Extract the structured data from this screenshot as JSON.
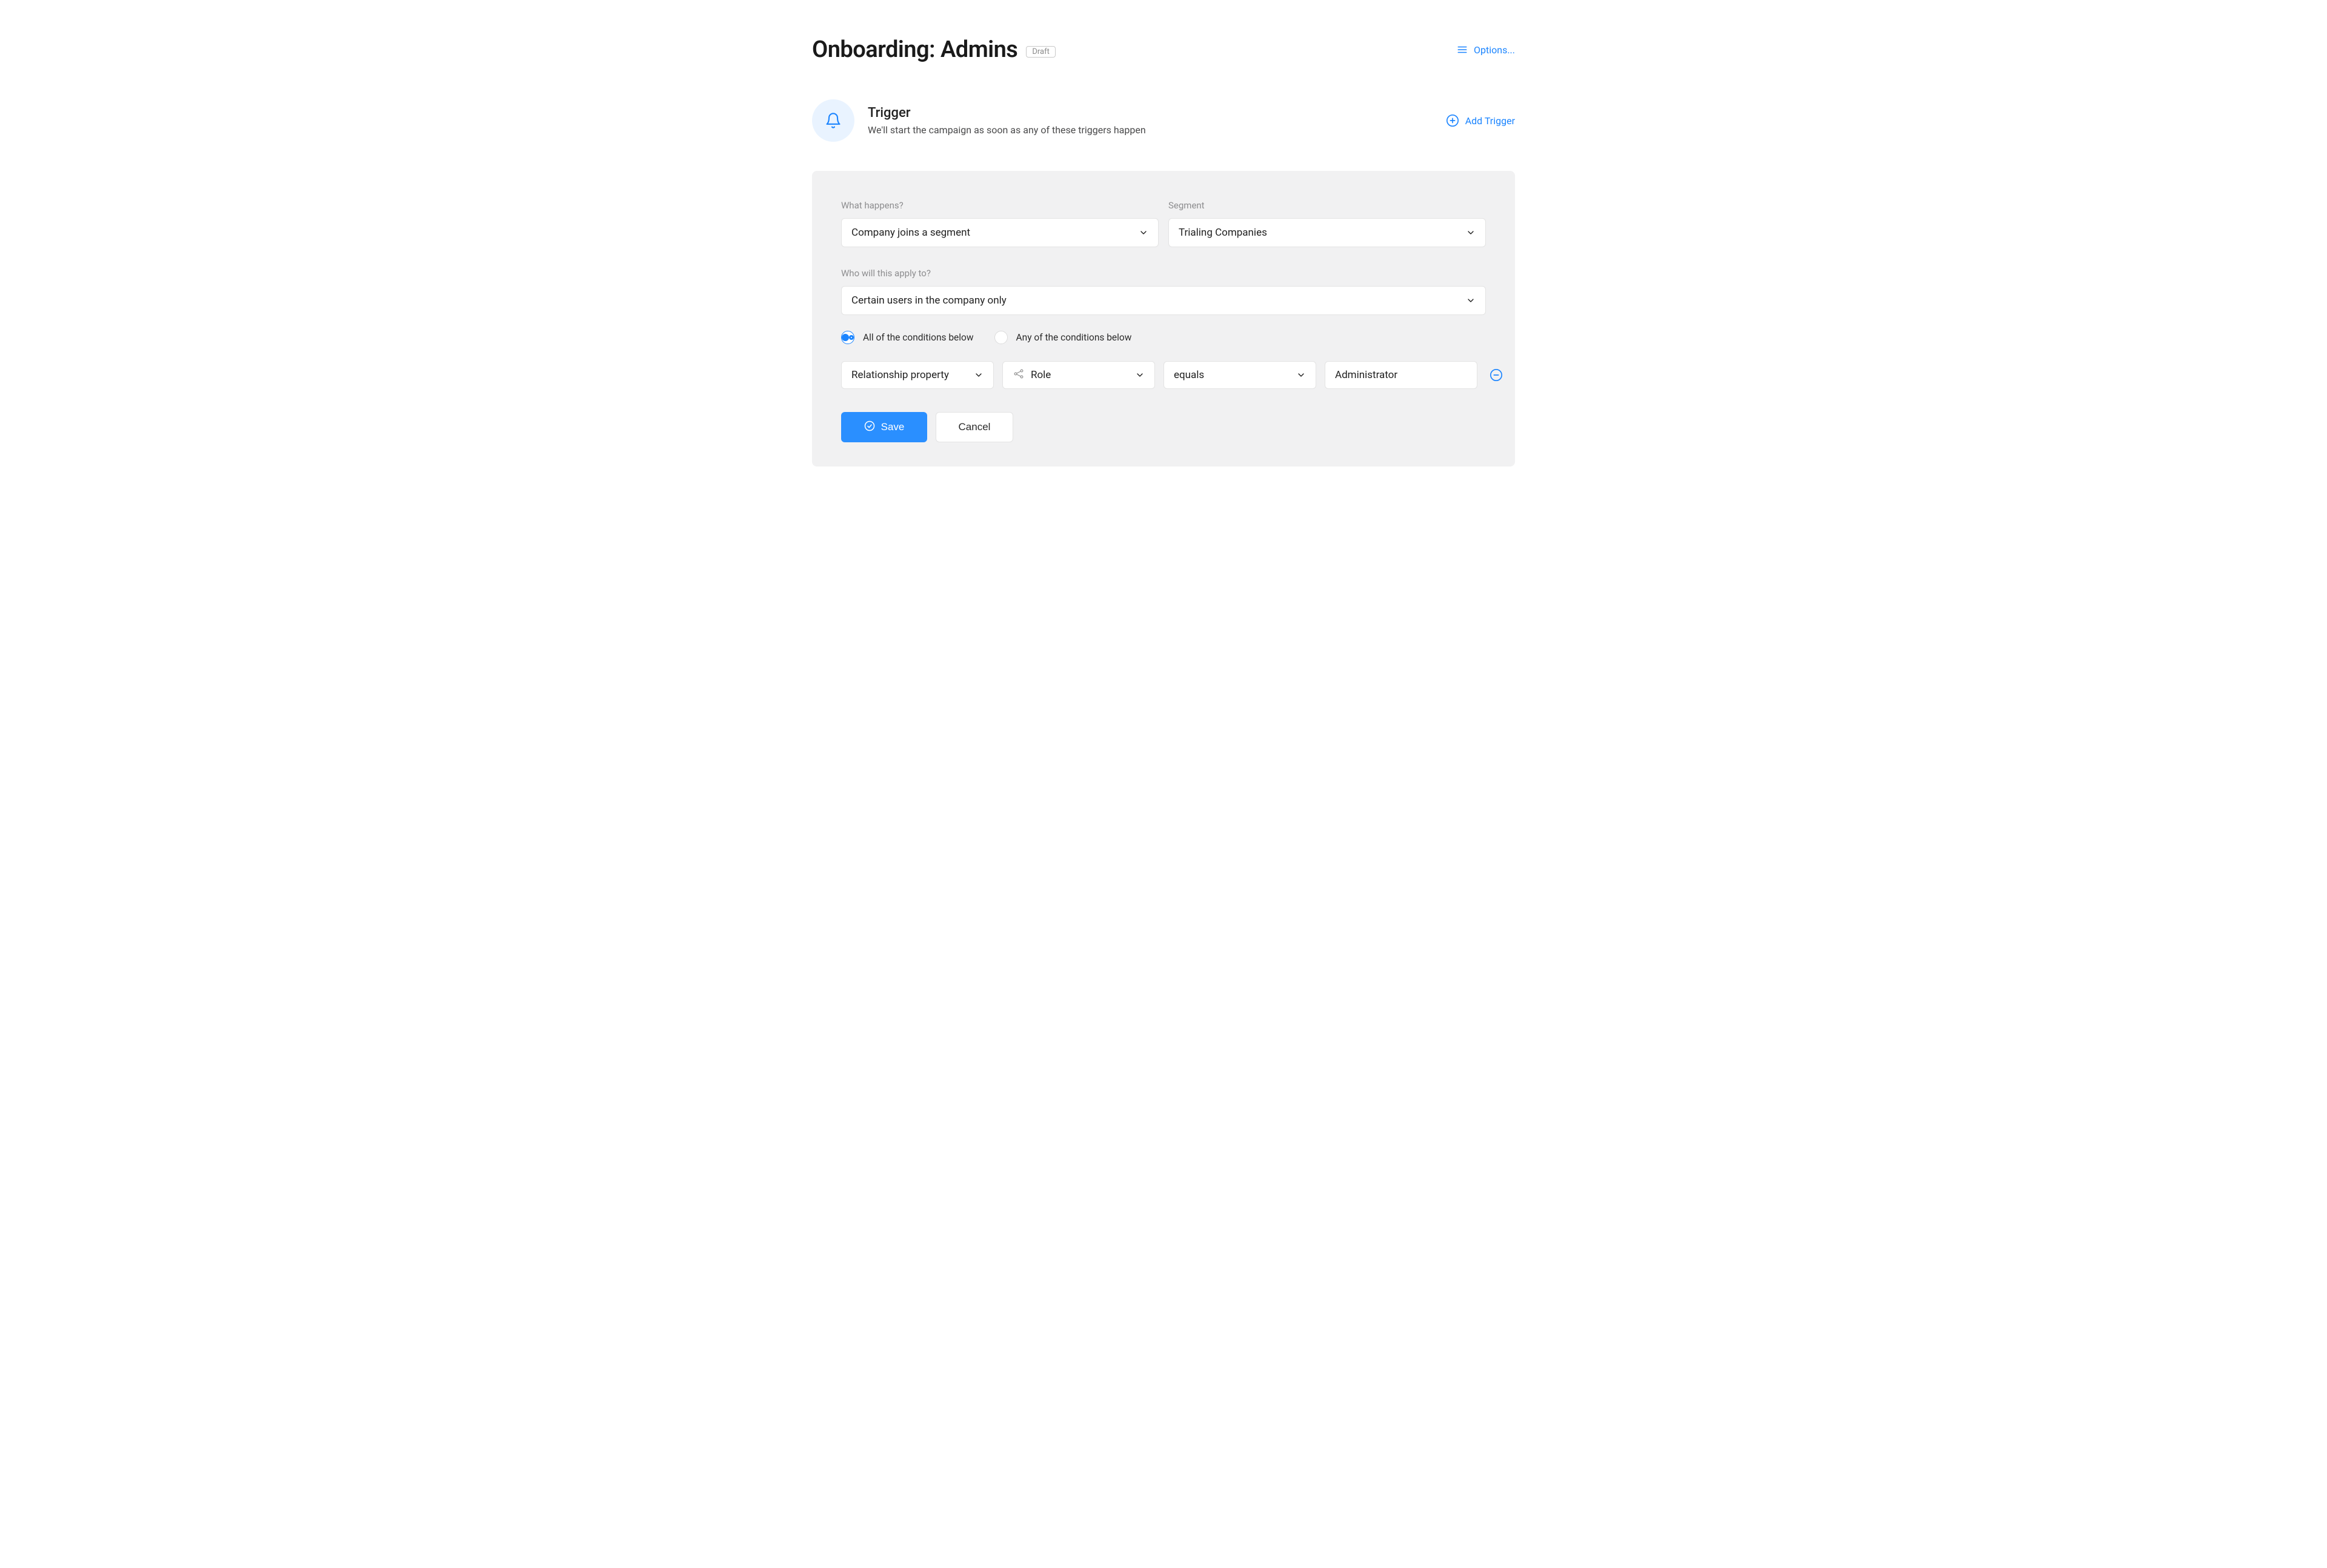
{
  "header": {
    "title": "Onboarding: Admins",
    "status_badge": "Draft",
    "options_label": "Options..."
  },
  "trigger": {
    "title": "Trigger",
    "subtitle": "We'll start the campaign as soon as any of these triggers happen",
    "add_label": "Add Trigger"
  },
  "panel": {
    "what_happens": {
      "label": "What happens?",
      "value": "Company joins a segment"
    },
    "segment": {
      "label": "Segment",
      "value": "Trialing Companies"
    },
    "apply_to": {
      "label": "Who will this apply to?",
      "value": "Certain users in the company only"
    },
    "match_mode": {
      "all_label": "All of the conditions below",
      "any_label": "Any of the conditions below",
      "selected": "all"
    },
    "condition": {
      "property_type": "Relationship property",
      "property_name": "Role",
      "operator": "equals",
      "value": "Administrator"
    },
    "buttons": {
      "save": "Save",
      "cancel": "Cancel"
    }
  },
  "colors": {
    "accent": "#1a84ff",
    "panel_bg": "#f1f1f2",
    "icon_bg": "#e9f3ff"
  }
}
